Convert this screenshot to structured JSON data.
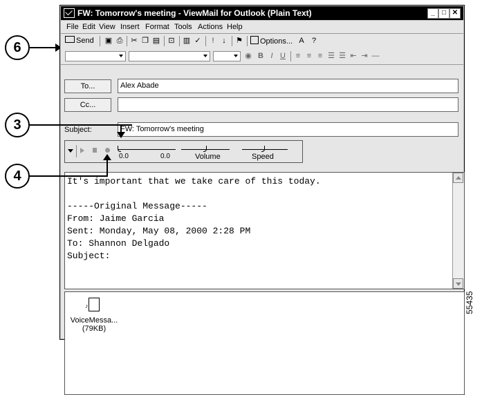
{
  "window": {
    "title": "FW: Tomorrow's meeting - ViewMail for Outlook (Plain Text)",
    "buttons": {
      "minimize": "_",
      "maximize": "□",
      "close": "✕"
    }
  },
  "menu": {
    "items": [
      "File",
      "Edit",
      "View",
      "Insert",
      "Format",
      "Tools",
      "Actions",
      "Help"
    ]
  },
  "toolbar": {
    "send_label": "Send",
    "options_label": "Options...",
    "icons": [
      "save-icon",
      "print-icon",
      "cut-icon",
      "copy-icon",
      "paste-icon",
      "attach-icon",
      "address-book-icon",
      "check-names-icon",
      "importance-high-icon",
      "importance-low-icon",
      "flag-icon",
      "options-icon",
      "font-icon",
      "help-icon"
    ]
  },
  "format_toolbar": {
    "bold": "B",
    "italic": "I",
    "underline": "U"
  },
  "form": {
    "to_button": "To...",
    "to_value": "Alex Abade",
    "cc_button": "Cc...",
    "cc_value": "",
    "subject_label": "Subject:",
    "subject_value": "FW: Tomorrow's meeting"
  },
  "player": {
    "position_start": "0.0",
    "position_end": "0.0",
    "volume_label": "Volume",
    "speed_label": "Speed"
  },
  "message_body": "It's important that we take care of this today.\n\n-----Original Message-----\nFrom: Jaime Garcia\nSent: Monday, May 08, 2000 2:28 PM\nTo: Shannon Delgado\nSubject:",
  "attachment": {
    "name": "VoiceMessa...",
    "size": "(79KB)"
  },
  "callouts": [
    "6",
    "3",
    "4"
  ],
  "figure_id": "55435"
}
